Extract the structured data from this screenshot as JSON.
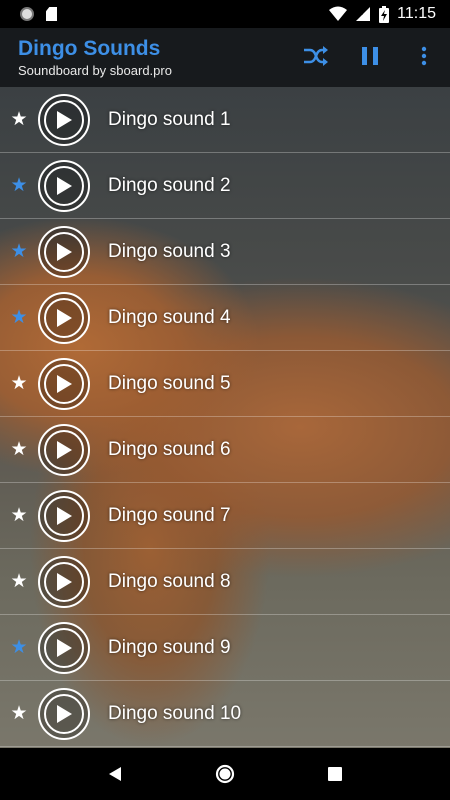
{
  "status_bar": {
    "time": "11:15",
    "icons": [
      "notification-dot-icon",
      "sd-card-icon",
      "wifi-icon",
      "signal-icon",
      "battery-charging-icon"
    ]
  },
  "app_bar": {
    "title": "Dingo Sounds",
    "subtitle": "Soundboard by sboard.pro",
    "actions": [
      "shuffle-icon",
      "pause-icon",
      "more-vert-icon"
    ],
    "accent_color": "#3d8fe6"
  },
  "sounds": [
    {
      "label": "Dingo sound 1",
      "favorite": false
    },
    {
      "label": "Dingo sound 2",
      "favorite": true
    },
    {
      "label": "Dingo sound 3",
      "favorite": true
    },
    {
      "label": "Dingo sound 4",
      "favorite": true
    },
    {
      "label": "Dingo sound 5",
      "favorite": false
    },
    {
      "label": "Dingo sound 6",
      "favorite": false
    },
    {
      "label": "Dingo sound 7",
      "favorite": false
    },
    {
      "label": "Dingo sound 8",
      "favorite": false
    },
    {
      "label": "Dingo sound 9",
      "favorite": true
    },
    {
      "label": "Dingo sound 10",
      "favorite": false
    }
  ],
  "colors": {
    "star_favorite": "#3d8fe6",
    "star_default": "#ffffff"
  },
  "nav_bar": {
    "buttons": [
      "back-icon",
      "home-icon",
      "recents-icon"
    ]
  }
}
